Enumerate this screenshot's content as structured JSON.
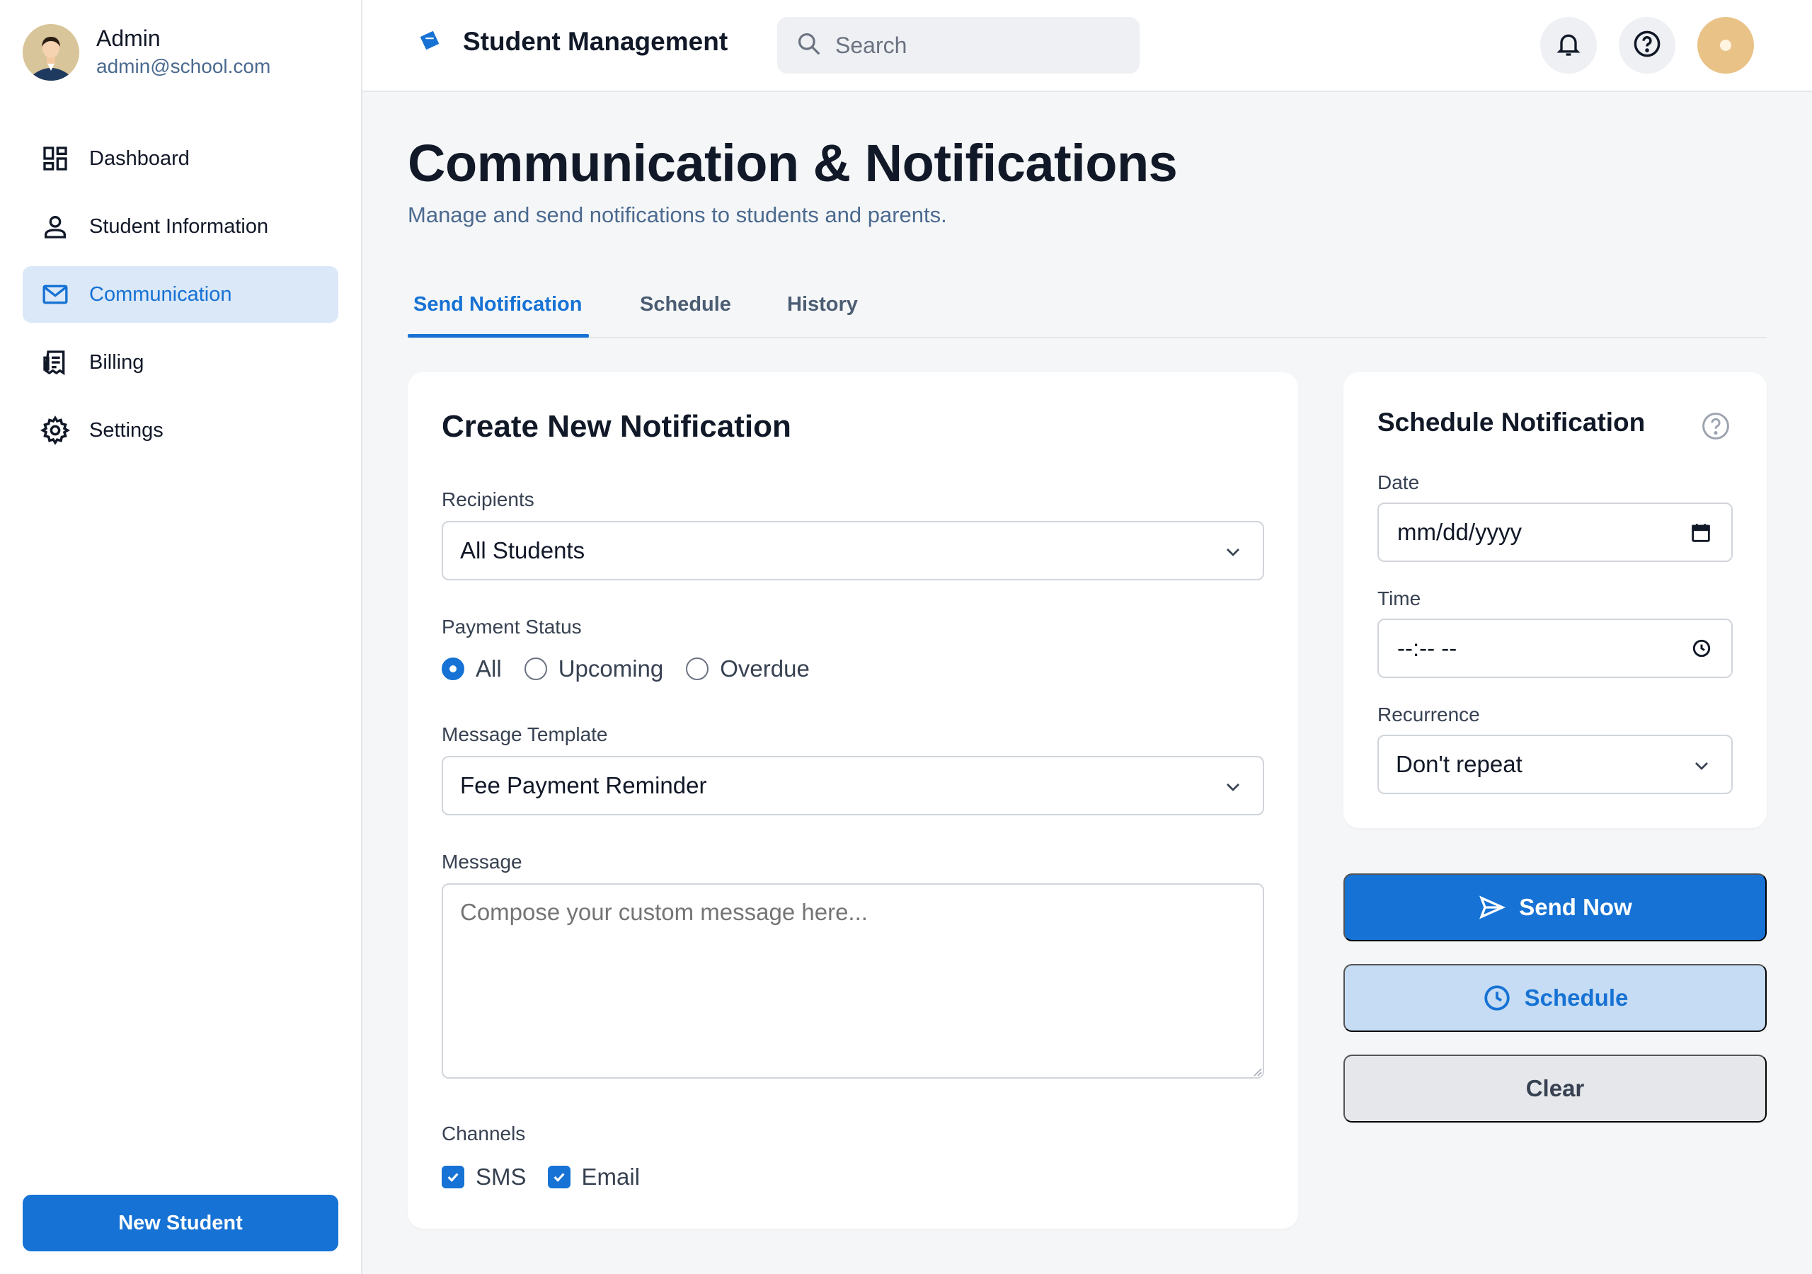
{
  "profile": {
    "name": "Admin",
    "email": "admin@school.com"
  },
  "sidebar": {
    "items": [
      {
        "label": "Dashboard",
        "icon": "dashboard-icon"
      },
      {
        "label": "Student Information",
        "icon": "person-icon"
      },
      {
        "label": "Communication",
        "icon": "mail-icon",
        "active": true
      },
      {
        "label": "Billing",
        "icon": "receipt-icon"
      },
      {
        "label": "Settings",
        "icon": "gear-icon"
      }
    ],
    "new_student_label": "New Student"
  },
  "header": {
    "title": "Student Management",
    "search_placeholder": "Search"
  },
  "page": {
    "title": "Communication & Notifications",
    "subtitle": "Manage and send notifications to students and parents."
  },
  "tabs": [
    {
      "label": "Send Notification",
      "active": true
    },
    {
      "label": "Schedule"
    },
    {
      "label": "History"
    }
  ],
  "create_form": {
    "title": "Create New Notification",
    "recipients_label": "Recipients",
    "recipients_value": "All Students",
    "payment_status_label": "Payment Status",
    "payment_options": [
      "All",
      "Upcoming",
      "Overdue"
    ],
    "payment_selected": "All",
    "template_label": "Message Template",
    "template_value": "Fee Payment Reminder",
    "message_label": "Message",
    "message_placeholder": "Compose your custom message here...",
    "channels_label": "Channels",
    "channels": [
      {
        "label": "SMS",
        "checked": true
      },
      {
        "label": "Email",
        "checked": true
      }
    ]
  },
  "schedule_form": {
    "title": "Schedule Notification",
    "date_label": "Date",
    "date_placeholder": "mm/dd/yyyy",
    "time_label": "Time",
    "time_placeholder": "--:-- --",
    "recurrence_label": "Recurrence",
    "recurrence_value": "Don't repeat"
  },
  "actions": {
    "send_now": "Send Now",
    "schedule": "Schedule",
    "clear": "Clear"
  },
  "colors": {
    "accent": "#1672d4",
    "accent_light": "#dbe8f8",
    "subtitle": "#4b6a8f",
    "background": "#f5f6f8"
  }
}
